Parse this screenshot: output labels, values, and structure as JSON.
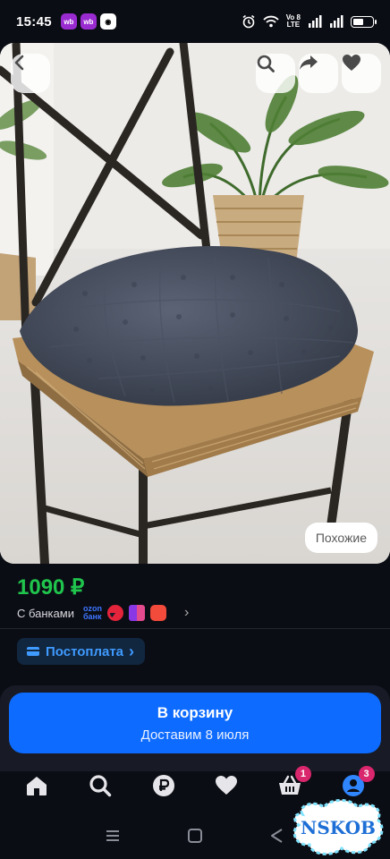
{
  "status_bar": {
    "time": "15:45",
    "app_badges": [
      {
        "text": "wb",
        "color": "#9a2bd1"
      },
      {
        "text": "wb",
        "color": "#9a2bd1"
      },
      {
        "text": "◉",
        "color": "#ffffff"
      }
    ],
    "network": "Vo 8\nLTE",
    "network_line1": "Vo 8",
    "network_line2": "LTE",
    "battery_level": 0.45
  },
  "photo": {
    "back_icon": "chevron-left-icon",
    "search_icon": "search-icon",
    "share_icon": "share-arrow-icon",
    "favorite_icon": "heart-icon",
    "similar_label": "Похожие"
  },
  "product": {
    "price": "1090 ₽",
    "bank_label": "С банками",
    "bank_logo_line1": "ozon",
    "bank_logo_line2": "банк",
    "bank_icons": [
      {
        "name": "bank-red-icon",
        "color": "#e3243b"
      },
      {
        "name": "bank-purple-icon",
        "color": "#8a37e6"
      },
      {
        "name": "bank-orange-icon",
        "color": "#f24a3b"
      }
    ],
    "postpay_label": "Постоплата",
    "postpay_chevron": "›"
  },
  "cart": {
    "title": "В корзину",
    "subtitle": "Доставим 8 июля"
  },
  "tab_bar": {
    "items": [
      {
        "name": "tab-home",
        "icon": "home-icon",
        "badge": ""
      },
      {
        "name": "tab-search",
        "icon": "search-icon",
        "badge": ""
      },
      {
        "name": "tab-finance",
        "icon": "ruble-icon",
        "badge": ""
      },
      {
        "name": "tab-favorites",
        "icon": "heart-icon",
        "badge": ""
      },
      {
        "name": "tab-cart",
        "icon": "basket-icon",
        "badge": "1"
      },
      {
        "name": "tab-profile",
        "icon": "profile-icon",
        "badge": "3"
      }
    ]
  },
  "watermark": {
    "text": "NSKOB"
  },
  "colors": {
    "price": "#20c54d",
    "accent": "#0d6bff",
    "postpay_text": "#3f9bff",
    "badge": "#d9266c",
    "background": "#0b0d14"
  }
}
